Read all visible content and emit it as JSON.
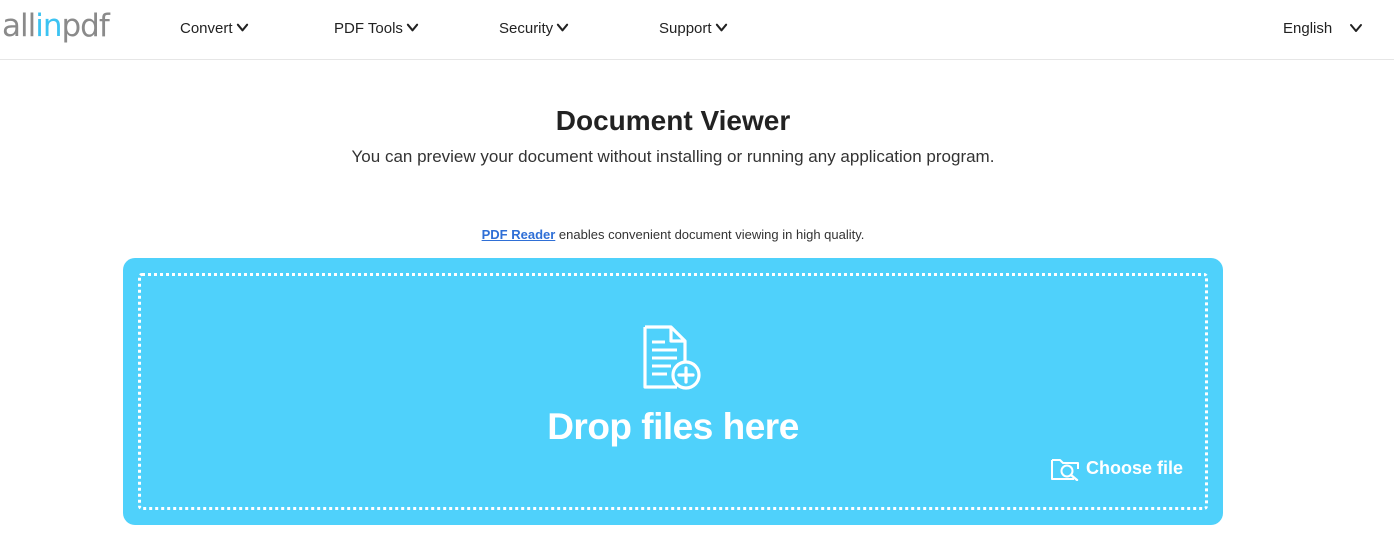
{
  "header": {
    "logo": {
      "part1": "all",
      "part2": "in",
      "part3": "pdf"
    },
    "nav": [
      {
        "label": "Convert",
        "icon": "chevron-down-icon"
      },
      {
        "label": "PDF Tools",
        "icon": "chevron-down-icon"
      },
      {
        "label": "Security",
        "icon": "chevron-down-icon"
      },
      {
        "label": "Support",
        "icon": "chevron-down-icon"
      }
    ],
    "language": {
      "label": "English",
      "icon": "chevron-down-icon"
    }
  },
  "main": {
    "title": "Document Viewer",
    "subtitle": "You can preview your document without installing or running any application program.",
    "reader_link": "PDF Reader",
    "reader_text": " enables convenient document viewing in high quality."
  },
  "dropzone": {
    "icon": "file-add-icon",
    "drop_text": "Drop files here",
    "choose_label": "Choose file",
    "choose_icon": "folder-search-icon"
  },
  "colors": {
    "accent": "#3cc3f2",
    "dropzone_bg": "#4fd1fb",
    "link": "#2f6fd6",
    "logo_gray": "#8a8a8a"
  }
}
